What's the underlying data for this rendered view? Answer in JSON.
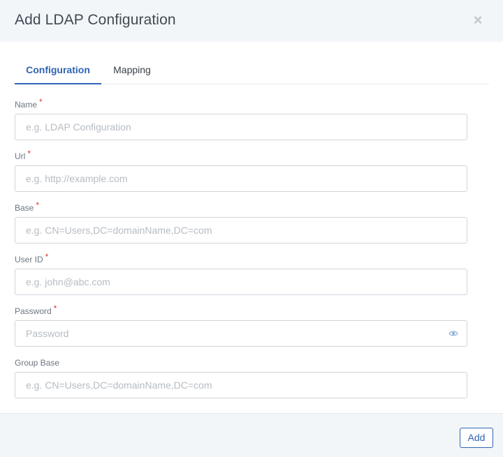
{
  "modal": {
    "title": "Add LDAP Configuration",
    "close_glyph": "×"
  },
  "tabs": [
    {
      "label": "Configuration",
      "active": true
    },
    {
      "label": "Mapping",
      "active": false
    }
  ],
  "fields": [
    {
      "label": "Name",
      "required": true,
      "placeholder": "e.g. LDAP Configuration",
      "value": ""
    },
    {
      "label": "Url",
      "required": true,
      "placeholder": "e.g. http://example.com",
      "value": ""
    },
    {
      "label": "Base",
      "required": true,
      "placeholder": "e.g. CN=Users,DC=domainName,DC=com",
      "value": ""
    },
    {
      "label": "User ID",
      "required": true,
      "placeholder": "e.g. john@abc.com",
      "value": ""
    },
    {
      "label": "Password",
      "required": true,
      "placeholder": "Password",
      "value": "",
      "icon": "eye-icon"
    },
    {
      "label": "Group Base",
      "required": false,
      "placeholder": "e.g. CN=Users,DC=domainName,DC=com",
      "value": ""
    }
  ],
  "required_marker": "*",
  "footer": {
    "add_label": "Add"
  },
  "colors": {
    "accent": "#2f64b3",
    "required": "#e0353a",
    "header_bg": "#f3f6f9"
  }
}
